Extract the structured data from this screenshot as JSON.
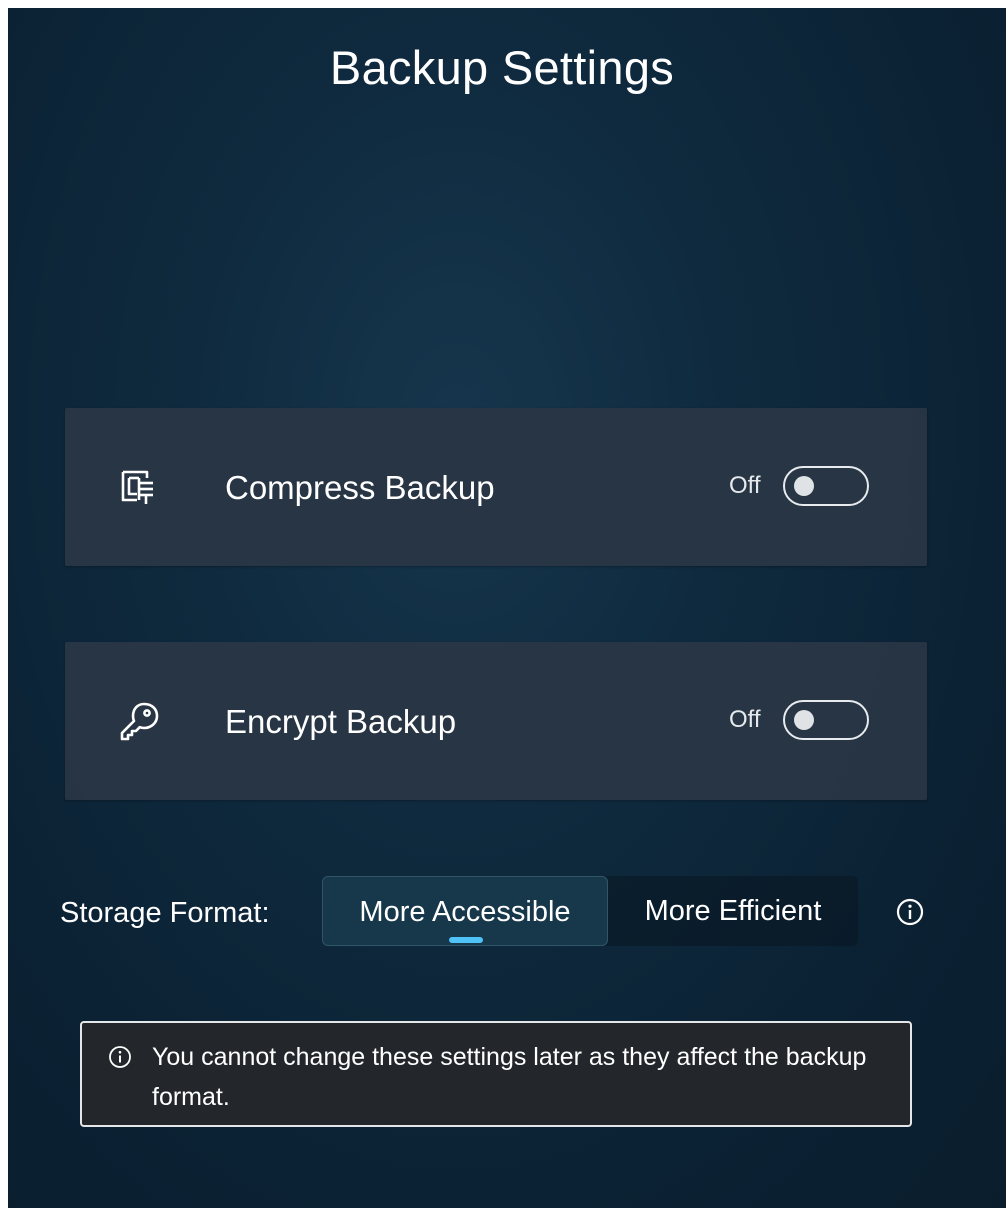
{
  "page": {
    "title": "Backup Settings"
  },
  "settings": [
    {
      "id": "compress",
      "label": "Compress Backup",
      "icon": "compress-icon",
      "state_label": "Off",
      "enabled": false
    },
    {
      "id": "encrypt",
      "label": "Encrypt Backup",
      "icon": "key-icon",
      "state_label": "Off",
      "enabled": false
    }
  ],
  "storage_format": {
    "label": "Storage Format:",
    "options": [
      {
        "label": "More Accessible",
        "selected": true
      },
      {
        "label": "More Efficient",
        "selected": false
      }
    ],
    "info_icon": "info-icon"
  },
  "notice": {
    "icon": "info-icon",
    "text": "You cannot change these settings later as they affect the backup format."
  },
  "colors": {
    "background": "#0f2a3e",
    "card": "#293644",
    "selected_indicator": "#4fc3f7",
    "notice_background": "#23272b"
  }
}
